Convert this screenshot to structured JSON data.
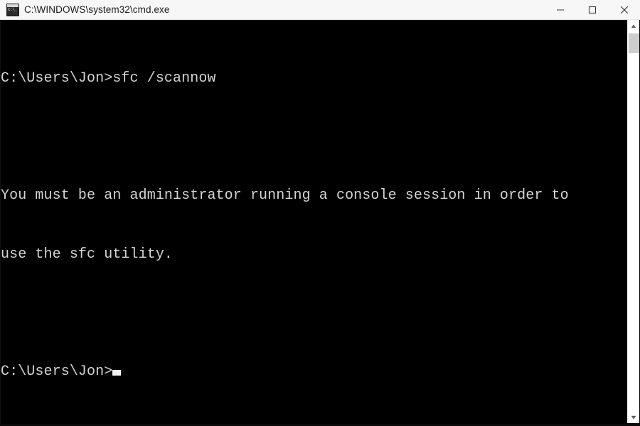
{
  "window": {
    "title": "C:\\WINDOWS\\system32\\cmd.exe",
    "app_icon_label": "c:\\_",
    "titlebar_bg": "#f7f7f7",
    "title_color": "#1c1c1c"
  },
  "controls": {
    "minimize_label": "Minimize",
    "maximize_label": "Maximize",
    "close_label": "Close"
  },
  "console": {
    "background": "#000000",
    "foreground": "#d4d4d4",
    "lines": [
      "C:\\Users\\Jon>sfc /scannow",
      "",
      "You must be an administrator running a console session in order to",
      "use the sfc utility.",
      "",
      "C:\\Users\\Jon>"
    ],
    "prompt_line": "C:\\Users\\Jon>",
    "command": "sfc /scannow",
    "message_line_1": "You must be an administrator running a console session in order to",
    "message_line_2": "use the sfc utility.",
    "cursor_visible": true
  },
  "scrollbar": {
    "up_arrow": "▲",
    "down_arrow": "▼",
    "thumb_color": "#cdcdcd",
    "track_color": "#ffffff"
  }
}
